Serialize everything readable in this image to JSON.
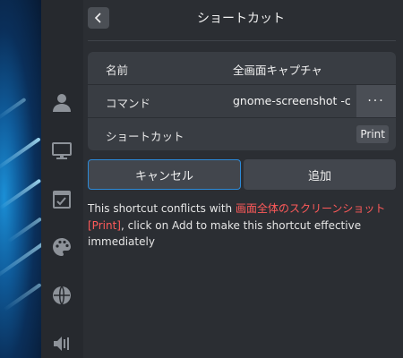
{
  "header": {
    "title": "ショートカット"
  },
  "form": {
    "name_label": "名前",
    "name_value": "全画面キャプチャ",
    "command_label": "コマンド",
    "command_value": "gnome-screenshot -c",
    "more_label": "···",
    "shortcut_label": "ショートカット",
    "shortcut_key": "Print"
  },
  "actions": {
    "cancel_label": "キャンセル",
    "add_label": "追加"
  },
  "message": {
    "part1": "This shortcut conflicts with ",
    "conflict_name": "画面全体のスクリーンショット",
    "conflict_key": "[Print]",
    "part2": ", click on Add to make this shortcut effective immediately"
  },
  "colors": {
    "accent": "#2d8ad8",
    "warning": "#ff5a5a",
    "background": "#2b2e33"
  },
  "sidebar_icons": [
    "account-icon",
    "display-icon",
    "datetime-icon",
    "personalization-icon",
    "network-icon",
    "sound-icon"
  ]
}
